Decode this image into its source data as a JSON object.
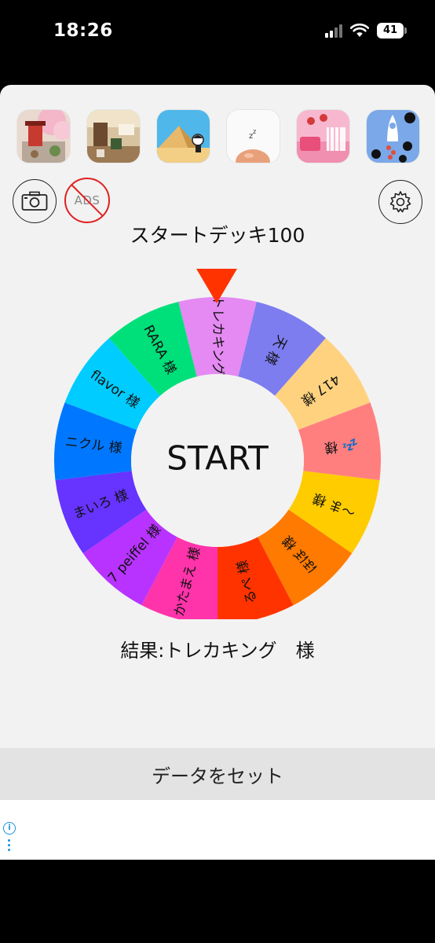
{
  "status_bar": {
    "time": "18:26",
    "battery": "41"
  },
  "app_icons": [
    {
      "name": "cherry-blossom-shrine-game-icon"
    },
    {
      "name": "cafe-room-escape-game-icon"
    },
    {
      "name": "desert-pyramid-game-icon"
    },
    {
      "name": "sleeping-egg-game-icon"
    },
    {
      "name": "pink-toy-room-game-icon"
    },
    {
      "name": "rocket-dots-game-icon"
    }
  ],
  "toolbar": {
    "camera_icon": "camera-icon",
    "no_ads_label": "ADS",
    "settings_icon": "gear-icon"
  },
  "deck_title": "スタートデッキ100",
  "wheel": {
    "center_label": "START",
    "pointer_color": "#ff3300",
    "segments": [
      {
        "label": "トレカキング",
        "color": "#e48af2"
      },
      {
        "label": "天 様",
        "color": "#7d7df0"
      },
      {
        "label": "417 様",
        "color": "#ffd27f"
      },
      {
        "label": "💤 様",
        "color": "#ff7f7f"
      },
      {
        "label": "〜ま 様",
        "color": "#ffcc00"
      },
      {
        "label": "ほぼ 様",
        "color": "#ff7a00"
      },
      {
        "label": "るぺ 様",
        "color": "#ff3300"
      },
      {
        "label": "かたまえ 様",
        "color": "#ff33aa"
      },
      {
        "label": "7 peiffel 様",
        "color": "#b833ff"
      },
      {
        "label": "まいろ 様",
        "color": "#6633ff"
      },
      {
        "label": "ニクル 様",
        "color": "#0077ff"
      },
      {
        "label": "flavor 様",
        "color": "#00ccff"
      },
      {
        "label": "RARA 様",
        "color": "#00e07a"
      }
    ]
  },
  "result": "結果:トレカキング　様",
  "set_data_button": "データをセット"
}
